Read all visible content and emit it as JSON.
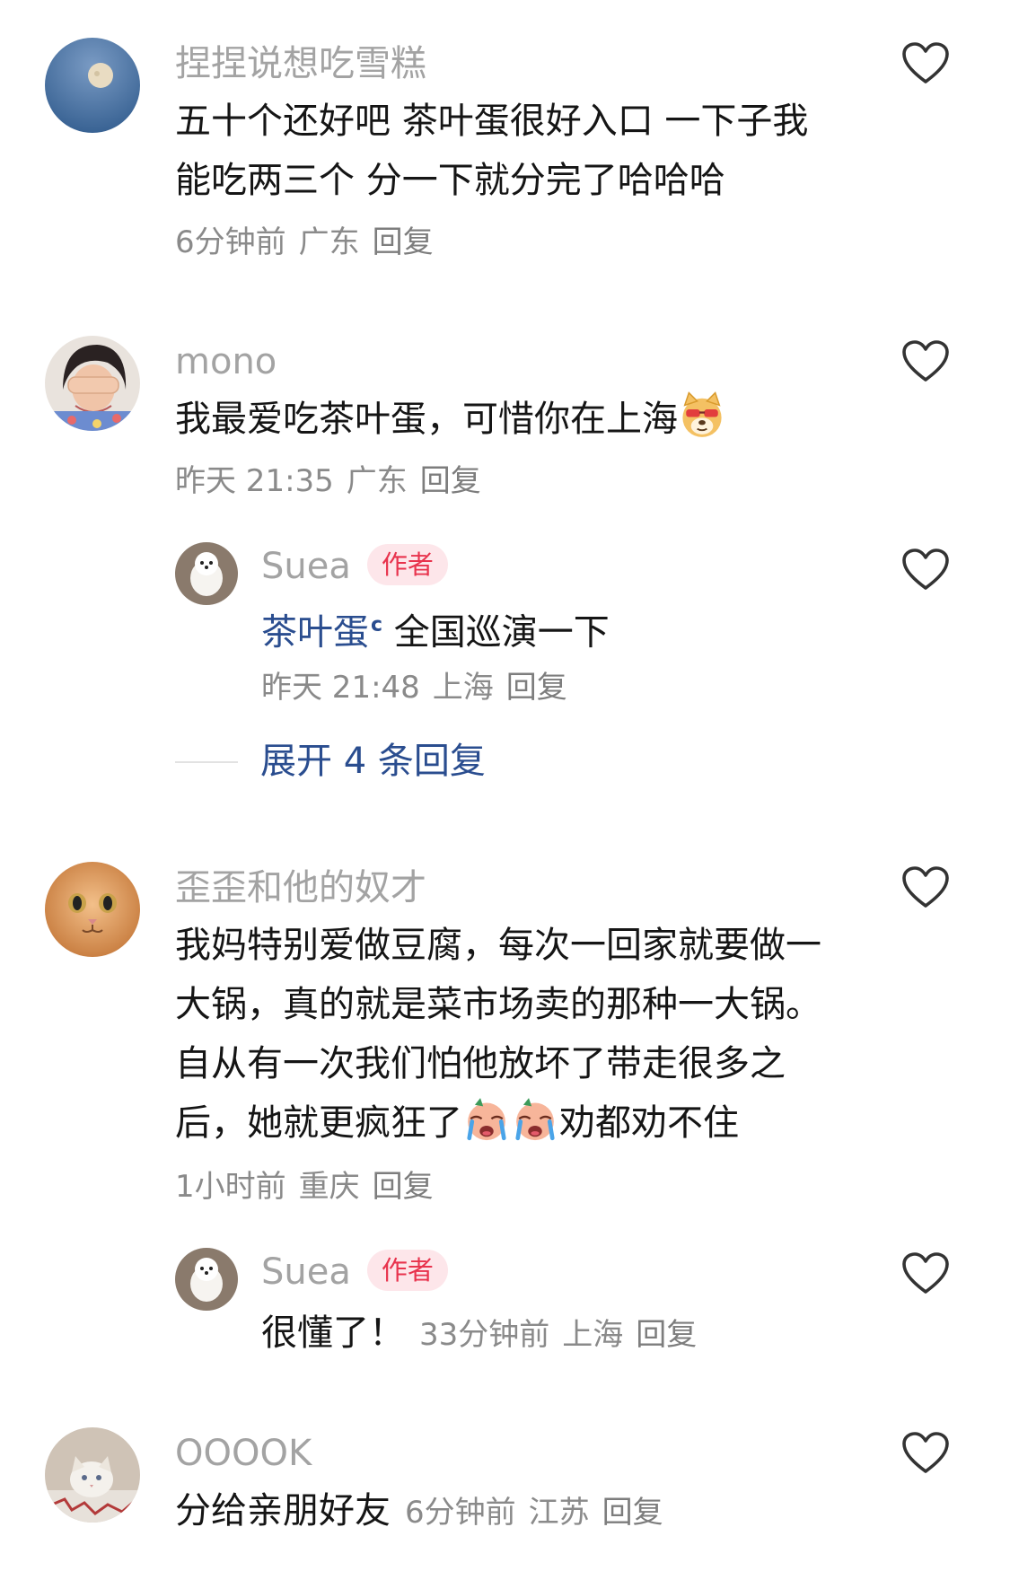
{
  "comments": [
    {
      "username": "捏捏说想吃雪糕",
      "lines": [
        "五十个还好吧 茶叶蛋很好入口 一下子我",
        "能吃两三个 分一下就分完了哈哈哈"
      ],
      "time": "6分钟前",
      "location": "广东",
      "reply": "回复",
      "avatar_icon": "moon-night-avatar-icon"
    },
    {
      "username": "mono",
      "text": "我最爱吃茶叶蛋，可惜你在上海",
      "emoji": "doge-sunglasses-emoji",
      "time": "昨天 21:35",
      "location": "广东",
      "reply": "回复",
      "avatar_icon": "girl-covering-eyes-avatar-icon",
      "replies": [
        {
          "username": "Suea",
          "badge": "作者",
          "link_text": "茶叶蛋",
          "text": " 全国巡演一下",
          "time": "昨天 21:48",
          "location": "上海",
          "reply": "回复"
        }
      ],
      "expand_label": "展开 4 条回复"
    },
    {
      "username": "歪歪和他的奴才",
      "lines": [
        "我妈特别爱做豆腐，每次一回家就要做一",
        "大锅，真的就是菜市场卖的那种一大锅。",
        "自从有一次我们怕他放坏了带走很多之"
      ],
      "last_line_start": "后，她就更疯狂了",
      "last_line_end": "劝都劝不住",
      "emoji": "crying-emoji",
      "time": "1小时前",
      "location": "重庆",
      "reply": "回复",
      "avatar_icon": "orange-cat-avatar-icon",
      "replies": [
        {
          "username": "Suea",
          "badge": "作者",
          "text": "很懂了！",
          "time": "33分钟前",
          "location": "上海",
          "reply": "回复"
        }
      ]
    },
    {
      "username": "OOOOK",
      "text": "分给亲朋好友",
      "time": "6分钟前",
      "location": "江苏",
      "reply": "回复",
      "avatar_icon": "white-kitten-avatar-icon"
    }
  ],
  "colors": {
    "username": "#a3a3a3",
    "link": "#2a4d8f",
    "author_badge_bg": "#fde6ea",
    "author_badge_text": "#e8334d"
  }
}
